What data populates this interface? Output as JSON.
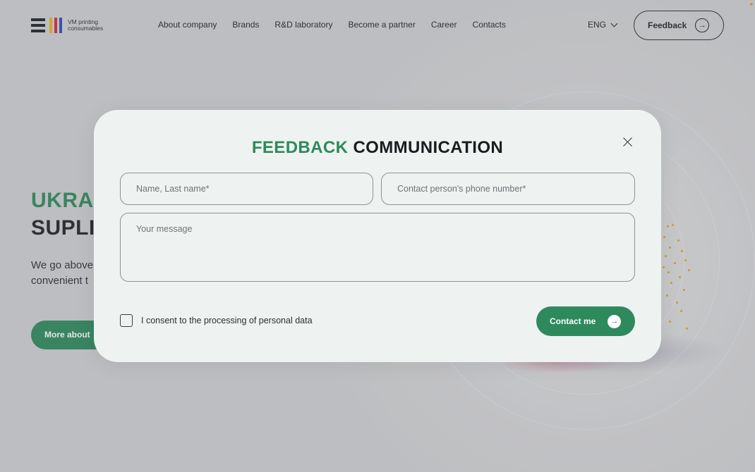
{
  "brand": {
    "name": "VM printing consumables",
    "name_line1": "VM printing",
    "name_line2": "consumables",
    "bar_colors": [
      "#e8b21e",
      "#d9283a",
      "#2a4fb7"
    ]
  },
  "nav": {
    "items": [
      "About company",
      "Brands",
      "R&D laboratory",
      "Become a partner",
      "Career",
      "Contacts"
    ]
  },
  "header": {
    "language": "ENG",
    "feedback_label": "Feedback"
  },
  "hero": {
    "title_line1": "UKRA",
    "title_line2": "SUPLI",
    "text_line1": "We go above",
    "text_line2": "convenient t",
    "button_label": "More about"
  },
  "modal": {
    "title_green": "FEEDBACK",
    "title_dark": "COMMUNICATION",
    "name_placeholder": "Name, Last name*",
    "phone_placeholder": "Contact person's phone number*",
    "message_placeholder": "Your message",
    "consent_label": "I consent to the processing of personal data",
    "consent_checked": false,
    "submit_label": "Contact me"
  },
  "colors": {
    "accent_green": "#2d8a5c",
    "text_dark": "#1f2326",
    "modal_bg": "#eef2f1"
  },
  "icons": {
    "close": "close-icon",
    "arrow": "arrow-right-circle-icon",
    "chevron": "chevron-down-icon"
  }
}
